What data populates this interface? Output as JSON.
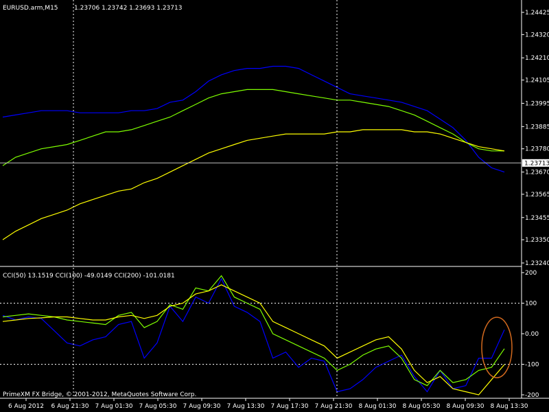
{
  "header": {
    "symbol": "EURUSD.arm,M15",
    "ohlc": "1.23706 1.23742 1.23693 1.23713"
  },
  "footer": {
    "copyright": "PrimeXM FX Bridge, © 2001-2012, MetaQuotes Software Corp."
  },
  "colors": {
    "background": "#000000",
    "axis": "#ffffff",
    "grid": "#ffffff",
    "ma_fast": "#0000ff",
    "ma_mid": "#7fff00",
    "ma_slow": "#ffff00",
    "cci50": "#0000ff",
    "cci100": "#7fff00",
    "cci200": "#ffff00",
    "circle": "#d2691e"
  },
  "chart_data": [
    {
      "type": "line",
      "panel": "price",
      "ylim": [
        1.2324,
        1.24425
      ],
      "y_ticks": [
        "1.24425",
        "1.24320",
        "1.24210",
        "1.24105",
        "1.23995",
        "1.23885",
        "1.23780",
        "1.23670",
        "1.23565",
        "1.23455",
        "1.23350",
        "1.23240"
      ],
      "current_price_label": "1.23713",
      "current_price": 1.23713,
      "x_ticks": [
        "6 Aug 2012",
        "6 Aug 21:30",
        "7 Aug 01:30",
        "7 Aug 05:30",
        "7 Aug 09:30",
        "7 Aug 13:30",
        "7 Aug 17:30",
        "7 Aug 21:30",
        "8 Aug 01:30",
        "8 Aug 05:30",
        "8 Aug 09:30",
        "8 Aug 13:30"
      ],
      "vertical_markers": [
        "6 Aug 21:30",
        "7 Aug 21:30"
      ],
      "grid": false,
      "series": [
        {
          "color_key": "ma_fast",
          "values": [
            1.2393,
            1.2394,
            1.2395,
            1.2396,
            1.2396,
            1.2396,
            1.2395,
            1.2395,
            1.2395,
            1.2395,
            1.2396,
            1.2396,
            1.2397,
            1.24,
            1.2401,
            1.2405,
            1.241,
            1.2413,
            1.2415,
            1.2416,
            1.2416,
            1.2417,
            1.2417,
            1.2416,
            1.2413,
            1.241,
            1.2407,
            1.2404,
            1.2403,
            1.2402,
            1.2401,
            1.24,
            1.2398,
            1.2396,
            1.2392,
            1.2388,
            1.2382,
            1.2374,
            1.2369,
            1.2367
          ]
        },
        {
          "color_key": "ma_mid",
          "values": [
            1.237,
            1.2374,
            1.2376,
            1.2378,
            1.2379,
            1.238,
            1.2382,
            1.2384,
            1.2386,
            1.2386,
            1.2387,
            1.2389,
            1.2391,
            1.2393,
            1.2396,
            1.2399,
            1.2402,
            1.2404,
            1.2405,
            1.2406,
            1.2406,
            1.2406,
            1.2405,
            1.2404,
            1.2403,
            1.2402,
            1.2401,
            1.2401,
            1.24,
            1.2399,
            1.2398,
            1.2396,
            1.2394,
            1.2391,
            1.2388,
            1.2385,
            1.2381,
            1.2378,
            1.2377,
            1.2377
          ]
        },
        {
          "color_key": "ma_slow",
          "values": [
            1.2335,
            1.2339,
            1.2342,
            1.2345,
            1.2347,
            1.2349,
            1.2352,
            1.2354,
            1.2356,
            1.2358,
            1.2359,
            1.2362,
            1.2364,
            1.2367,
            1.237,
            1.2373,
            1.2376,
            1.2378,
            1.238,
            1.2382,
            1.2383,
            1.2384,
            1.2385,
            1.2385,
            1.2385,
            1.2385,
            1.2386,
            1.2386,
            1.2387,
            1.2387,
            1.2387,
            1.2387,
            1.2386,
            1.2386,
            1.2385,
            1.2383,
            1.2381,
            1.2379,
            1.2378,
            1.2377
          ]
        }
      ]
    },
    {
      "type": "line",
      "panel": "indicator",
      "title": "CCI(50) 13.1519 CCI(100) -49.0149 CCI(200) -101.0181",
      "ylim": [
        -200,
        200
      ],
      "y_ticks": [
        "200",
        "100",
        "0.00",
        "-100",
        "-200"
      ],
      "levels": [
        100,
        -100
      ],
      "series": [
        {
          "name": "CCI(50)",
          "color_key": "cci50",
          "values": [
            60,
            45,
            55,
            50,
            10,
            -30,
            -40,
            -20,
            -10,
            30,
            40,
            -80,
            -30,
            90,
            40,
            120,
            100,
            180,
            90,
            70,
            40,
            -80,
            -60,
            -110,
            -80,
            -90,
            -190,
            -180,
            -150,
            -110,
            -90,
            -70,
            -140,
            -190,
            -120,
            -180,
            -170,
            -80,
            -80,
            13
          ]
        },
        {
          "name": "CCI(100)",
          "color_key": "cci100",
          "values": [
            55,
            60,
            65,
            60,
            55,
            45,
            40,
            35,
            30,
            60,
            70,
            20,
            40,
            95,
            80,
            150,
            140,
            190,
            120,
            100,
            80,
            0,
            -20,
            -40,
            -60,
            -80,
            -120,
            -100,
            -70,
            -50,
            -40,
            -80,
            -150,
            -170,
            -120,
            -160,
            -150,
            -120,
            -110,
            -49
          ]
        },
        {
          "name": "CCI(200)",
          "color_key": "cci200",
          "values": [
            40,
            45,
            50,
            52,
            55,
            55,
            50,
            45,
            45,
            55,
            60,
            50,
            60,
            90,
            100,
            130,
            140,
            160,
            140,
            120,
            100,
            40,
            20,
            0,
            -20,
            -40,
            -80,
            -60,
            -40,
            -20,
            -10,
            -50,
            -120,
            -160,
            -140,
            -180,
            -190,
            -200,
            -150,
            -101
          ]
        }
      ]
    }
  ]
}
